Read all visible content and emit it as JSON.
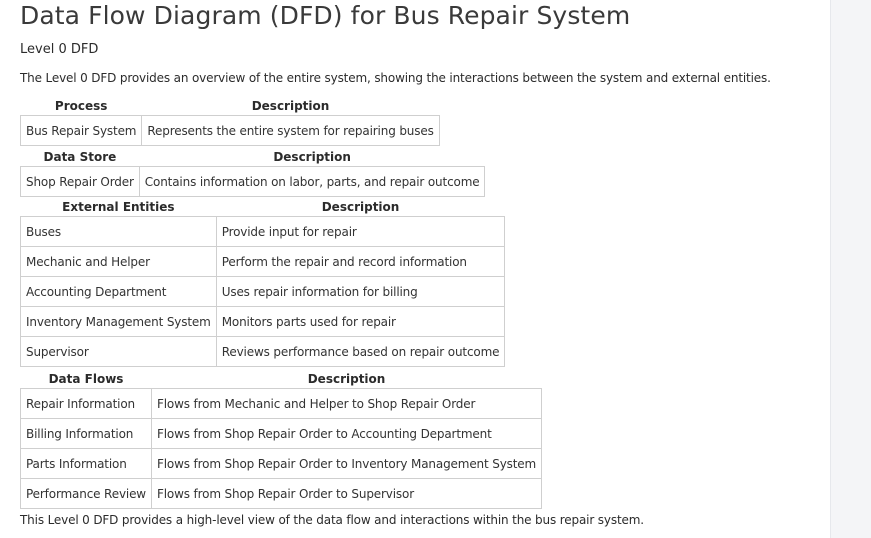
{
  "doc": {
    "title": "Data Flow Diagram (DFD) for Bus Repair System",
    "subtitle": "Level 0 DFD",
    "intro": "The Level 0 DFD provides an overview of the entire system, showing the interactions between the system and external entities.",
    "outro": "This Level 0 DFD provides a high-level view of the data flow and interactions within the bus repair system."
  },
  "process_table": {
    "headers": [
      "Process",
      "Description"
    ],
    "rows": [
      [
        "Bus Repair System",
        "Represents the entire system for repairing buses"
      ]
    ]
  },
  "datastore_table": {
    "headers": [
      "Data Store",
      "Description"
    ],
    "rows": [
      [
        "Shop Repair Order",
        "Contains information on labor, parts, and repair outcome"
      ]
    ]
  },
  "entities_table": {
    "headers": [
      "External Entities",
      "Description"
    ],
    "rows": [
      [
        "Buses",
        "Provide input for repair"
      ],
      [
        "Mechanic and Helper",
        "Perform the repair and record information"
      ],
      [
        "Accounting Department",
        "Uses repair information for billing"
      ],
      [
        "Inventory Management System",
        "Monitors parts used for repair"
      ],
      [
        "Supervisor",
        "Reviews performance based on repair outcome"
      ]
    ]
  },
  "flows_table": {
    "headers": [
      "Data Flows",
      "Description"
    ],
    "rows": [
      [
        "Repair Information",
        "Flows from Mechanic and Helper to Shop Repair Order"
      ],
      [
        "Billing Information",
        "Flows from Shop Repair Order to Accounting Department"
      ],
      [
        "Parts Information",
        "Flows from Shop Repair Order to Inventory Management System"
      ],
      [
        "Performance Review",
        "Flows from Shop Repair Order to Supervisor"
      ]
    ]
  }
}
